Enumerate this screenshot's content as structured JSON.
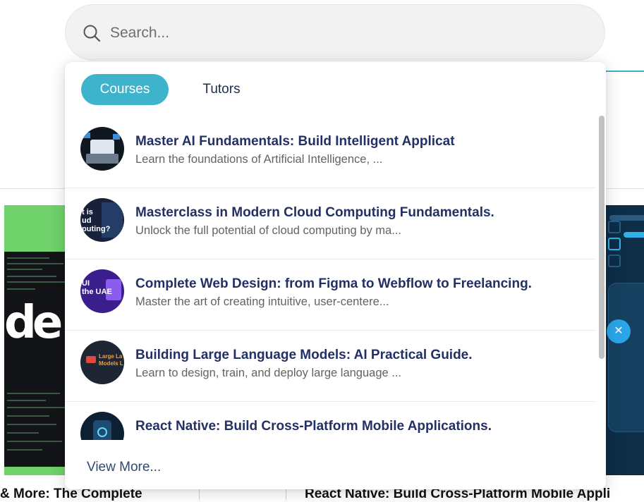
{
  "search": {
    "placeholder": "Search..."
  },
  "tabs": [
    {
      "label": "Courses",
      "active": true
    },
    {
      "label": "Tutors",
      "active": false
    }
  ],
  "results": [
    {
      "title": "Master AI Fundamentals: Build Intelligent Applicat",
      "description": "Learn the foundations of Artificial Intelligence, ...",
      "thumb_text": ""
    },
    {
      "title": "Masterclass in Modern Cloud Computing Fundamentals.",
      "description": "Unlock the full potential of cloud computing by ma...",
      "thumb_text": "t is\nud\nputing?"
    },
    {
      "title": "Complete Web Design: from Figma to Webflow to Freelancing.",
      "description": "Master the art of creating intuitive, user-centere...",
      "thumb_text": "UI\nthe UAE"
    },
    {
      "title": "Building Large Language Models: AI Practical Guide.",
      "description": "Learn to design, train, and deploy large language ...",
      "thumb_text": "Large La\nModels L"
    },
    {
      "title": "React Native: Build Cross-Platform Mobile Applications.",
      "description": "",
      "thumb_text": ""
    }
  ],
  "view_more_label": "View More...",
  "background": {
    "left_card_title": "& More: The Complete",
    "right_card_title": "React Native: Build Cross-Platform Mobile Appli",
    "left_card_logo": "de"
  },
  "colors": {
    "accent": "#3db4cb",
    "title": "#233066",
    "description": "#636363"
  }
}
